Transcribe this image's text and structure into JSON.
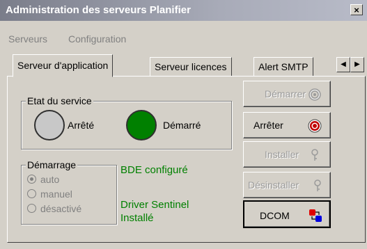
{
  "window": {
    "title": "Administration des serveurs Planifier",
    "close_glyph": "×"
  },
  "menu": {
    "items": [
      "Serveurs",
      "Configuration"
    ]
  },
  "tabs": [
    "Serveur d'application",
    "Serveur licences",
    "Alert SMTP"
  ],
  "tab_scroll": {
    "left": "◀",
    "right": "▶"
  },
  "service_state": {
    "group_label": "Etat du service",
    "stopped_label": "Arrêté",
    "started_label": "Démarré",
    "stopped_color": "#c8c8c8",
    "started_color": "#008000"
  },
  "startup": {
    "group_label": "Démarrage",
    "options": [
      "auto",
      "manuel",
      "désactivé"
    ],
    "selected": "auto",
    "enabled": false
  },
  "status": {
    "bde": "BDE configuré",
    "driver_line1": "Driver Sentinel",
    "driver_line2": "Installé"
  },
  "buttons": [
    {
      "label": "Démarrer",
      "enabled": false,
      "icon": "target-gray-icon"
    },
    {
      "label": "Arrêter",
      "enabled": true,
      "icon": "target-red-icon"
    },
    {
      "label": "Installer",
      "enabled": false,
      "icon": "key-icon"
    },
    {
      "label": "Désinstaller",
      "enabled": false,
      "icon": "key-icon"
    },
    {
      "label": "DCOM",
      "enabled": true,
      "icon": "dcom-icon"
    }
  ]
}
